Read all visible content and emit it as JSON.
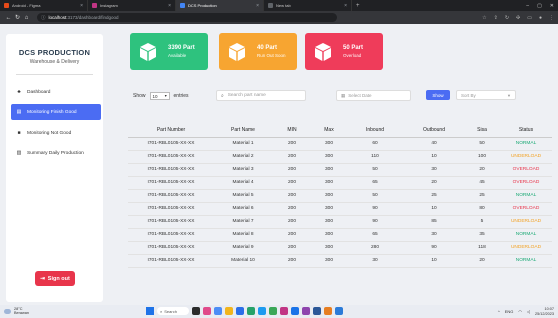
{
  "browser": {
    "tabs": [
      {
        "title": "Android - Figma",
        "active": false,
        "color": "#e64a19"
      },
      {
        "title": "Instagram",
        "active": false,
        "color": "#c13584"
      },
      {
        "title": "DCS Production",
        "active": true,
        "color": "#4285f4"
      },
      {
        "title": "New tab",
        "active": false,
        "color": "#5f6368"
      }
    ],
    "url_host": "localhost",
    "url_path": ":3173/dashboard/findgood"
  },
  "sidebar": {
    "title": "DCS PRODUCTION",
    "subtitle": "Warehouse & Delivery",
    "items": [
      {
        "label": "Dashboard",
        "icon": "dashboard-icon"
      },
      {
        "label": "Monitoring Finish Good",
        "icon": "clipboard-icon",
        "active": true
      },
      {
        "label": "Monitoring Not Good",
        "icon": "box-icon"
      },
      {
        "label": "Summary Daily Production",
        "icon": "chart-icon"
      }
    ],
    "signout": "Sign out"
  },
  "cards": [
    {
      "value": "3390 Part",
      "label": "Available",
      "color": "#2ec27e"
    },
    {
      "value": "40 Part",
      "label": "Run Out Soon",
      "color": "#f7a531"
    },
    {
      "value": "50 Part",
      "label": "Overload",
      "color": "#ef3c5a"
    }
  ],
  "controls": {
    "show_label": "Show",
    "entries_value": "10",
    "entries_label": "entries",
    "search_placeholder": "Search part name",
    "date_placeholder": "Select Date",
    "show_button": "Show",
    "sort_placeholder": "Sort By"
  },
  "table": {
    "headers": [
      "Part Number",
      "Part Name",
      "MIN",
      "Max",
      "Inbound",
      "Outbound",
      "Sisa",
      "Status"
    ],
    "rows": [
      [
        "I701-RBL0105-XX-XX",
        "Material 1",
        "200",
        "300",
        "60",
        "40",
        "50",
        "NORMAL"
      ],
      [
        "I701-RBL0105-XX-XX",
        "Material 2",
        "200",
        "300",
        "110",
        "10",
        "100",
        "UNDERLOAD"
      ],
      [
        "I701-RBL0105-XX-XX",
        "Material 3",
        "200",
        "300",
        "50",
        "30",
        "20",
        "OVERLOAD"
      ],
      [
        "I701-RBL0105-XX-XX",
        "Material 4",
        "200",
        "300",
        "65",
        "20",
        "45",
        "OVERLOAD"
      ],
      [
        "I701-RBL0105-XX-XX",
        "Material 5",
        "200",
        "300",
        "50",
        "25",
        "25",
        "NORMAL"
      ],
      [
        "I701-RBL0105-XX-XX",
        "Material 6",
        "200",
        "300",
        "90",
        "10",
        "80",
        "OVERLOAD"
      ],
      [
        "I701-RBL0105-XX-XX",
        "Material 7",
        "200",
        "300",
        "90",
        "85",
        "5",
        "UNDERLOAD"
      ],
      [
        "I701-RBL0105-XX-XX",
        "Material 8",
        "200",
        "300",
        "65",
        "30",
        "35",
        "NORMAL"
      ],
      [
        "I701-RBL0105-XX-XX",
        "Material 9",
        "200",
        "300",
        "280",
        "90",
        "118",
        "UNDERLOAD"
      ],
      [
        "I701-RBL0105-XX-XX",
        "Material 10",
        "200",
        "300",
        "30",
        "10",
        "20",
        "NORMAL"
      ]
    ]
  },
  "taskbar": {
    "weather_temp": "28°C",
    "weather_desc": "Berawan",
    "search_label": "Search",
    "clock_time": "10:07",
    "clock_date": "25/12/2023",
    "lang": "ENG"
  }
}
